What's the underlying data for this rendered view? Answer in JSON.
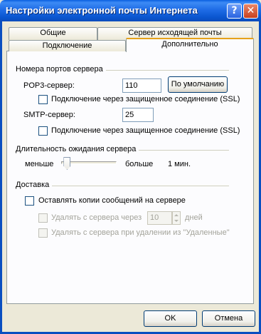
{
  "window": {
    "title": "Настройки электронной почты Интернета",
    "help_glyph": "?",
    "close_glyph": "✕"
  },
  "tabs": {
    "row_top": [
      "Общие",
      "Сервер исходящей почты"
    ],
    "row_bottom": [
      "Подключение",
      "Дополнительно"
    ],
    "active": "Дополнительно"
  },
  "ports": {
    "group_title": "Номера портов сервера",
    "pop3_label": "POP3-сервер:",
    "pop3_value": "110",
    "default_button": "По умолчанию",
    "pop3_ssl_label": "Подключение через защищенное соединение (SSL)",
    "pop3_ssl_checked": false,
    "smtp_label": "SMTP-сервер:",
    "smtp_value": "25",
    "smtp_ssl_label": "Подключение через защищенное соединение (SSL)",
    "smtp_ssl_checked": false
  },
  "timeout": {
    "group_title": "Длительность ожидания сервера",
    "less_label": "меньше",
    "more_label": "больше",
    "value_label": "1 мин.",
    "level": 0.05
  },
  "delivery": {
    "group_title": "Доставка",
    "keep_copies_label": "Оставлять копии сообщений на сервере",
    "keep_copies_checked": false,
    "remove_after_label": "Удалять с сервера через",
    "remove_after_value": "10",
    "days_label": "дней",
    "remove_deleted_label": "Удалять с сервера при удалении из \"Удаленные\""
  },
  "footer": {
    "ok_label": "OK",
    "cancel_label": "Отмена"
  },
  "colors": {
    "titlebar": "#0a56d0",
    "dialog_bg": "#ece9d8",
    "panel_bg": "#fcfcfe",
    "active_tab_accent": "#e6a21a"
  }
}
